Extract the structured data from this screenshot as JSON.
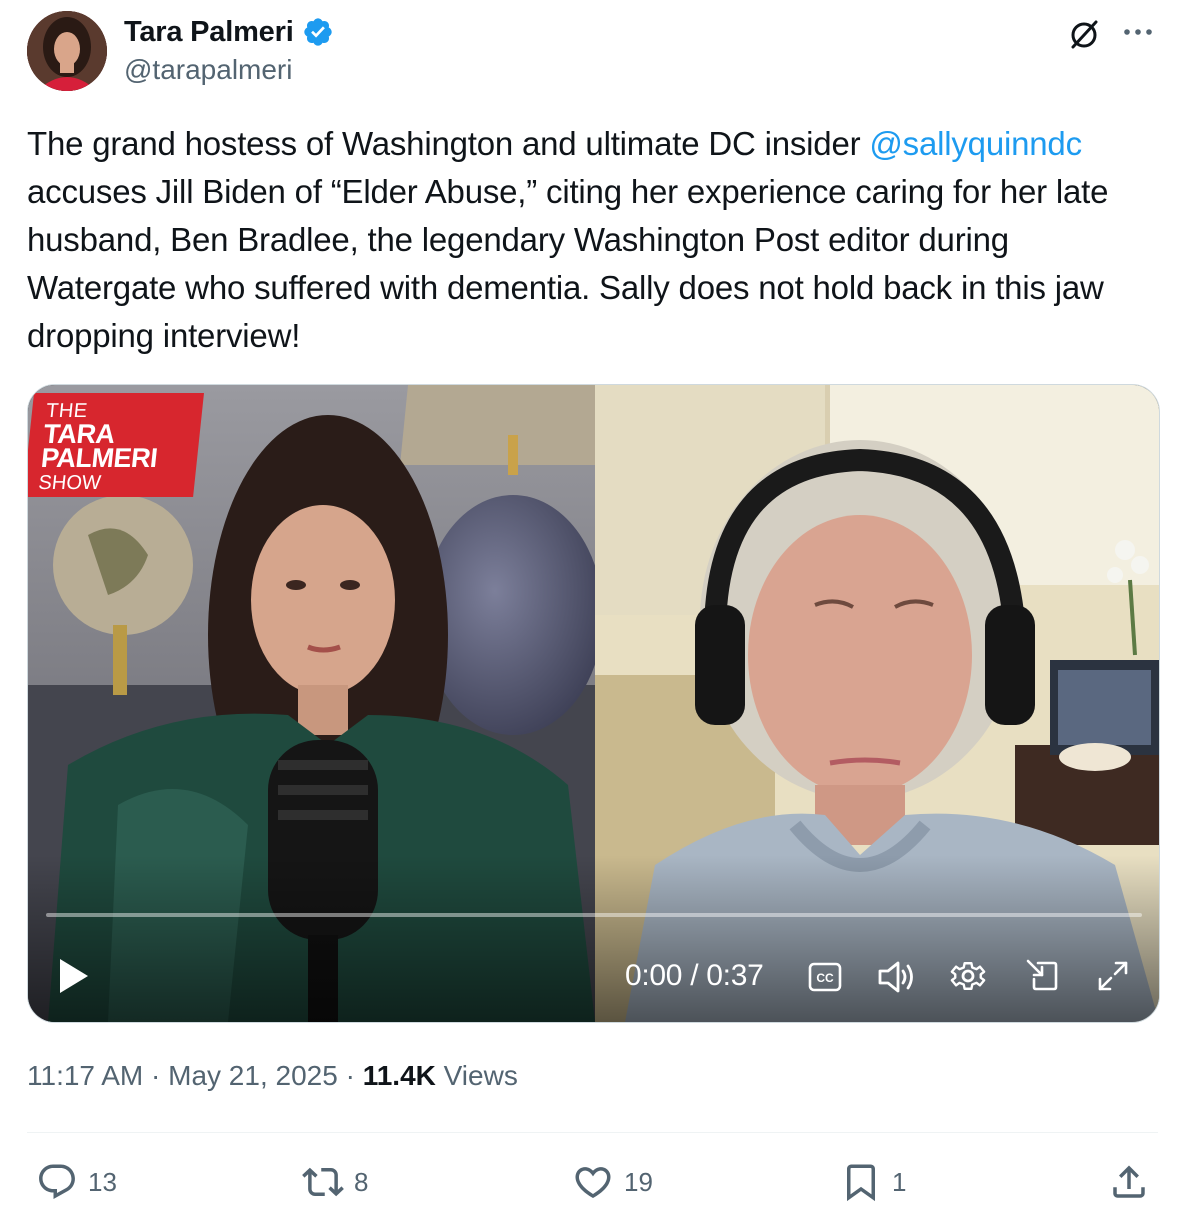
{
  "author": {
    "display_name": "Tara Palmeri",
    "handle": "@tarapalmeri",
    "verified": true,
    "verified_color": "#1d9bf0"
  },
  "header_icons": {
    "grok": "grok-icon",
    "more": "more-icon"
  },
  "tweet": {
    "text_before_mention": "The grand hostess of Washington and ultimate DC insider ",
    "mention": "@sallyquinndc",
    "text_after_mention": " accuses Jill Biden of “Elder Abuse,” citing her experience caring for her late husband, Ben Bradlee, the legendary Washington Post editor during Watergate who suffered with dementia. Sally does not hold back in this jaw dropping interview!",
    "mention_color": "#1d9bf0"
  },
  "video": {
    "show_logo": {
      "line1": "THE",
      "line2": "TARA",
      "line3": "PALMERI",
      "line4": "SHOW",
      "color": "#d7262e"
    },
    "time_display": "0:00 / 0:37",
    "progress": 0.0,
    "controls": [
      "play-icon",
      "captions-icon",
      "volume-icon",
      "settings-icon",
      "picture-in-picture-icon",
      "fullscreen-icon"
    ]
  },
  "meta": {
    "time": "11:17 AM",
    "separator": " · ",
    "date": "May 21, 2025",
    "views_count": "11.4K",
    "views_label": " Views"
  },
  "actions": {
    "replies": "13",
    "reposts": "8",
    "likes": "19",
    "bookmarks": "1"
  }
}
